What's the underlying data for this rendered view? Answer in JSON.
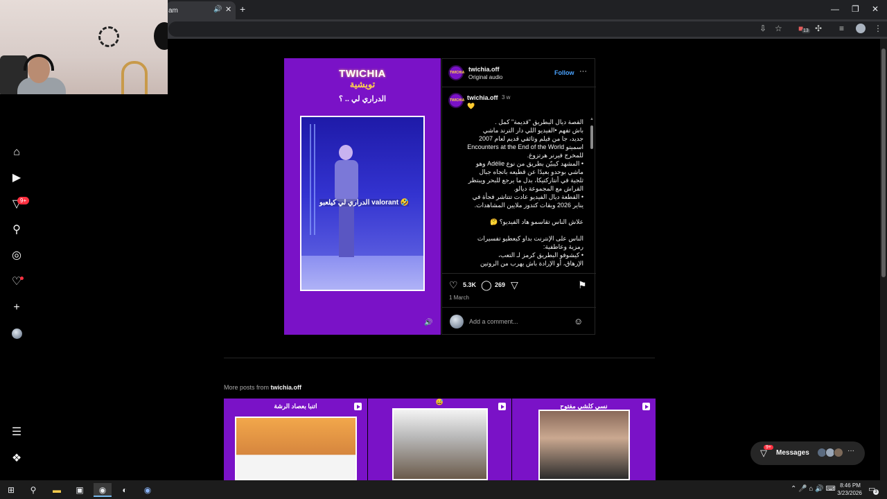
{
  "browser": {
    "tab_title": "am",
    "tab_audio_icon": "speaker-icon",
    "tab_close": "✕",
    "new_tab": "+",
    "window_controls": [
      "—",
      "❐",
      "✕"
    ],
    "extension_badge": "13"
  },
  "nav": {
    "notifications_badge": "9+"
  },
  "post": {
    "media": {
      "brand": "TWICHIA",
      "brand_ar": "تويشية",
      "caption": "الدراري لي .. ؟",
      "video_overlay": "الدراري لي كيلعبو valorant 🤣"
    },
    "header": {
      "avatar_text": "TWICHIA",
      "username": "twichia.off",
      "audio": "Original audio",
      "follow": "Follow",
      "more": "···"
    },
    "comment": {
      "username": "twichia.off",
      "time": "3 w",
      "emoji": "💛",
      "paragraphs": [
        "القصة ديال البطريق \"قديمة\" كمل .\nباش تفهم •الفيديو اللي دار الترند ماشي جديد، جا من فيلم وثائقي قديم لعام 2007 اسميتو Encounters at the End of the World للمخرج فيرنر هرتزوغ.",
        "• المشهد كيبيّن بطريق من نوع Adélie وهو ماشي بوحدو بعيدًا عن قطيعه باتجاه جبال ثلجية في أنتاركتيكا، بدل ما يرجع للبحر ويبتظر القراش مع المجموعة ديالو.",
        "• القطعة ديال الفيديو عادت تتتاشر فجأة في يناير 2026 وبقات كتدوز ملايين المشاهدات.",
        "علاش الناس تقاسمو هاد الفيديو؟ 🤔",
        "الناس على الإنترنت بداو كيعطيو تفسيرات رمزية وعاطفية:",
        "• كيشوفو البطريق كرمز لـ التعب،",
        "الإرهاق، أو الإرادة باش يهرب من الروتين"
      ]
    },
    "likes": "5.3K",
    "comments": "269",
    "date": "1 March",
    "add_comment_placeholder": "Add a comment..."
  },
  "more_posts": {
    "prefix": "More posts from ",
    "username": "twichia.off",
    "items": [
      {
        "title": "اتنبا بعصاد الرشة"
      },
      {
        "title": "😅"
      },
      {
        "title": "نسي كلشي مفتوح"
      }
    ]
  },
  "messages": {
    "label": "Messages",
    "badge": "9+",
    "more": "···"
  },
  "taskbar": {
    "time": "8:46 PM",
    "date": "3/23/2026",
    "notification_count": "3"
  },
  "colors": {
    "brand_purple": "#7a12c7",
    "accent_blue": "#4aa3ff",
    "badge_red": "#ff3040"
  }
}
